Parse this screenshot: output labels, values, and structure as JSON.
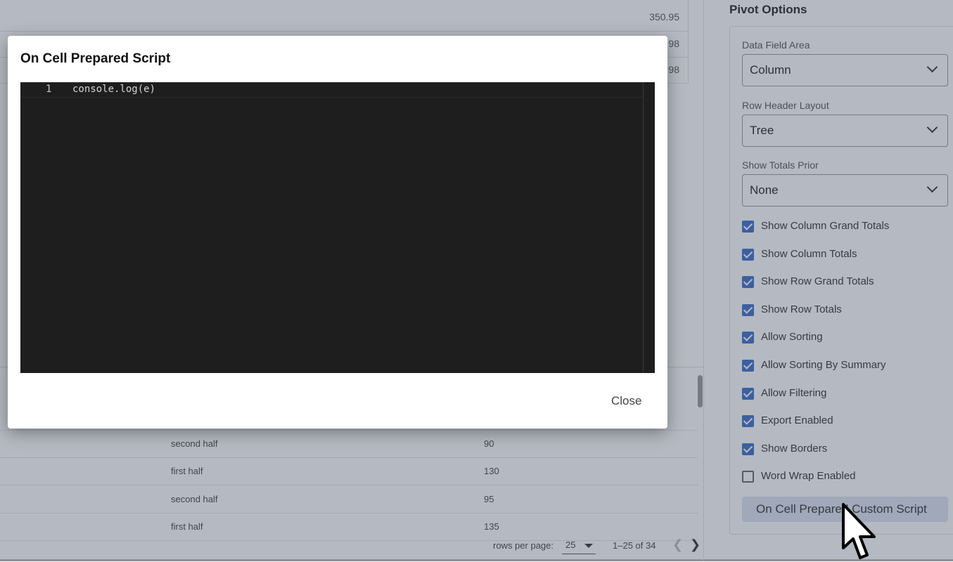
{
  "background": {
    "top_values": [
      "350.95",
      "98",
      "98"
    ],
    "grid_rows": [
      {
        "period": "second half",
        "value": "90"
      },
      {
        "period": "first half",
        "value": "130"
      },
      {
        "period": "second half",
        "value": "95"
      },
      {
        "period": "first half",
        "value": "135"
      }
    ],
    "pager": {
      "rows_per_page_label": "rows per page:",
      "rows_per_page_value": "25",
      "range": "1–25 of 34"
    }
  },
  "panel": {
    "title": "Pivot Options",
    "data_field_area": {
      "label": "Data Field Area",
      "value": "Column"
    },
    "row_header_layout": {
      "label": "Row Header Layout",
      "value": "Tree"
    },
    "show_totals_prior": {
      "label": "Show Totals Prior",
      "value": "None"
    },
    "checkboxes": [
      {
        "label": "Show Column Grand Totals",
        "checked": true
      },
      {
        "label": "Show Column Totals",
        "checked": true
      },
      {
        "label": "Show Row Grand Totals",
        "checked": true
      },
      {
        "label": "Show Row Totals",
        "checked": true
      },
      {
        "label": "Allow Sorting",
        "checked": true
      },
      {
        "label": "Allow Sorting By Summary",
        "checked": true
      },
      {
        "label": "Allow Filtering",
        "checked": true
      },
      {
        "label": "Export Enabled",
        "checked": true
      },
      {
        "label": "Show Borders",
        "checked": true
      },
      {
        "label": "Word Wrap Enabled",
        "checked": false
      }
    ],
    "script_button": "On Cell Prepared Custom Script"
  },
  "modal": {
    "title": "On Cell Prepared Script",
    "line_number": "1",
    "code": "console.log(e)",
    "close_label": "Close"
  },
  "colors": {
    "accent": "#3d6fcc",
    "editor_bg": "#1e1e1e",
    "overlay": "rgba(60,72,92,0.38)"
  }
}
